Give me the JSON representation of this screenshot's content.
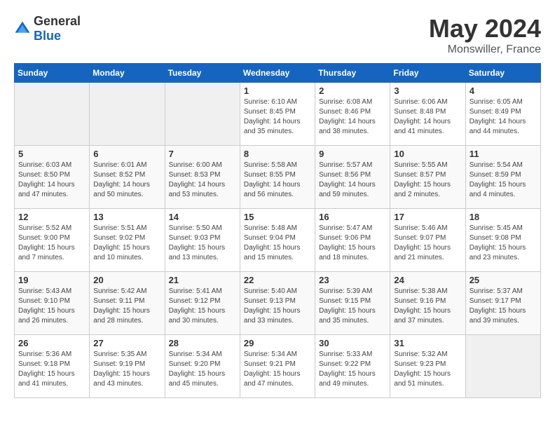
{
  "header": {
    "logo_general": "General",
    "logo_blue": "Blue",
    "title": "May 2024",
    "subtitle": "Monswiller, France"
  },
  "calendar": {
    "weekdays": [
      "Sunday",
      "Monday",
      "Tuesday",
      "Wednesday",
      "Thursday",
      "Friday",
      "Saturday"
    ],
    "weeks": [
      [
        {
          "day": "",
          "info": ""
        },
        {
          "day": "",
          "info": ""
        },
        {
          "day": "",
          "info": ""
        },
        {
          "day": "1",
          "info": "Sunrise: 6:10 AM\nSunset: 8:45 PM\nDaylight: 14 hours\nand 35 minutes."
        },
        {
          "day": "2",
          "info": "Sunrise: 6:08 AM\nSunset: 8:46 PM\nDaylight: 14 hours\nand 38 minutes."
        },
        {
          "day": "3",
          "info": "Sunrise: 6:06 AM\nSunset: 8:48 PM\nDaylight: 14 hours\nand 41 minutes."
        },
        {
          "day": "4",
          "info": "Sunrise: 6:05 AM\nSunset: 8:49 PM\nDaylight: 14 hours\nand 44 minutes."
        }
      ],
      [
        {
          "day": "5",
          "info": "Sunrise: 6:03 AM\nSunset: 8:50 PM\nDaylight: 14 hours\nand 47 minutes."
        },
        {
          "day": "6",
          "info": "Sunrise: 6:01 AM\nSunset: 8:52 PM\nDaylight: 14 hours\nand 50 minutes."
        },
        {
          "day": "7",
          "info": "Sunrise: 6:00 AM\nSunset: 8:53 PM\nDaylight: 14 hours\nand 53 minutes."
        },
        {
          "day": "8",
          "info": "Sunrise: 5:58 AM\nSunset: 8:55 PM\nDaylight: 14 hours\nand 56 minutes."
        },
        {
          "day": "9",
          "info": "Sunrise: 5:57 AM\nSunset: 8:56 PM\nDaylight: 14 hours\nand 59 minutes."
        },
        {
          "day": "10",
          "info": "Sunrise: 5:55 AM\nSunset: 8:57 PM\nDaylight: 15 hours\nand 2 minutes."
        },
        {
          "day": "11",
          "info": "Sunrise: 5:54 AM\nSunset: 8:59 PM\nDaylight: 15 hours\nand 4 minutes."
        }
      ],
      [
        {
          "day": "12",
          "info": "Sunrise: 5:52 AM\nSunset: 9:00 PM\nDaylight: 15 hours\nand 7 minutes."
        },
        {
          "day": "13",
          "info": "Sunrise: 5:51 AM\nSunset: 9:02 PM\nDaylight: 15 hours\nand 10 minutes."
        },
        {
          "day": "14",
          "info": "Sunrise: 5:50 AM\nSunset: 9:03 PM\nDaylight: 15 hours\nand 13 minutes."
        },
        {
          "day": "15",
          "info": "Sunrise: 5:48 AM\nSunset: 9:04 PM\nDaylight: 15 hours\nand 15 minutes."
        },
        {
          "day": "16",
          "info": "Sunrise: 5:47 AM\nSunset: 9:06 PM\nDaylight: 15 hours\nand 18 minutes."
        },
        {
          "day": "17",
          "info": "Sunrise: 5:46 AM\nSunset: 9:07 PM\nDaylight: 15 hours\nand 21 minutes."
        },
        {
          "day": "18",
          "info": "Sunrise: 5:45 AM\nSunset: 9:08 PM\nDaylight: 15 hours\nand 23 minutes."
        }
      ],
      [
        {
          "day": "19",
          "info": "Sunrise: 5:43 AM\nSunset: 9:10 PM\nDaylight: 15 hours\nand 26 minutes."
        },
        {
          "day": "20",
          "info": "Sunrise: 5:42 AM\nSunset: 9:11 PM\nDaylight: 15 hours\nand 28 minutes."
        },
        {
          "day": "21",
          "info": "Sunrise: 5:41 AM\nSunset: 9:12 PM\nDaylight: 15 hours\nand 30 minutes."
        },
        {
          "day": "22",
          "info": "Sunrise: 5:40 AM\nSunset: 9:13 PM\nDaylight: 15 hours\nand 33 minutes."
        },
        {
          "day": "23",
          "info": "Sunrise: 5:39 AM\nSunset: 9:15 PM\nDaylight: 15 hours\nand 35 minutes."
        },
        {
          "day": "24",
          "info": "Sunrise: 5:38 AM\nSunset: 9:16 PM\nDaylight: 15 hours\nand 37 minutes."
        },
        {
          "day": "25",
          "info": "Sunrise: 5:37 AM\nSunset: 9:17 PM\nDaylight: 15 hours\nand 39 minutes."
        }
      ],
      [
        {
          "day": "26",
          "info": "Sunrise: 5:36 AM\nSunset: 9:18 PM\nDaylight: 15 hours\nand 41 minutes."
        },
        {
          "day": "27",
          "info": "Sunrise: 5:35 AM\nSunset: 9:19 PM\nDaylight: 15 hours\nand 43 minutes."
        },
        {
          "day": "28",
          "info": "Sunrise: 5:34 AM\nSunset: 9:20 PM\nDaylight: 15 hours\nand 45 minutes."
        },
        {
          "day": "29",
          "info": "Sunrise: 5:34 AM\nSunset: 9:21 PM\nDaylight: 15 hours\nand 47 minutes."
        },
        {
          "day": "30",
          "info": "Sunrise: 5:33 AM\nSunset: 9:22 PM\nDaylight: 15 hours\nand 49 minutes."
        },
        {
          "day": "31",
          "info": "Sunrise: 5:32 AM\nSunset: 9:23 PM\nDaylight: 15 hours\nand 51 minutes."
        },
        {
          "day": "",
          "info": ""
        }
      ]
    ]
  }
}
